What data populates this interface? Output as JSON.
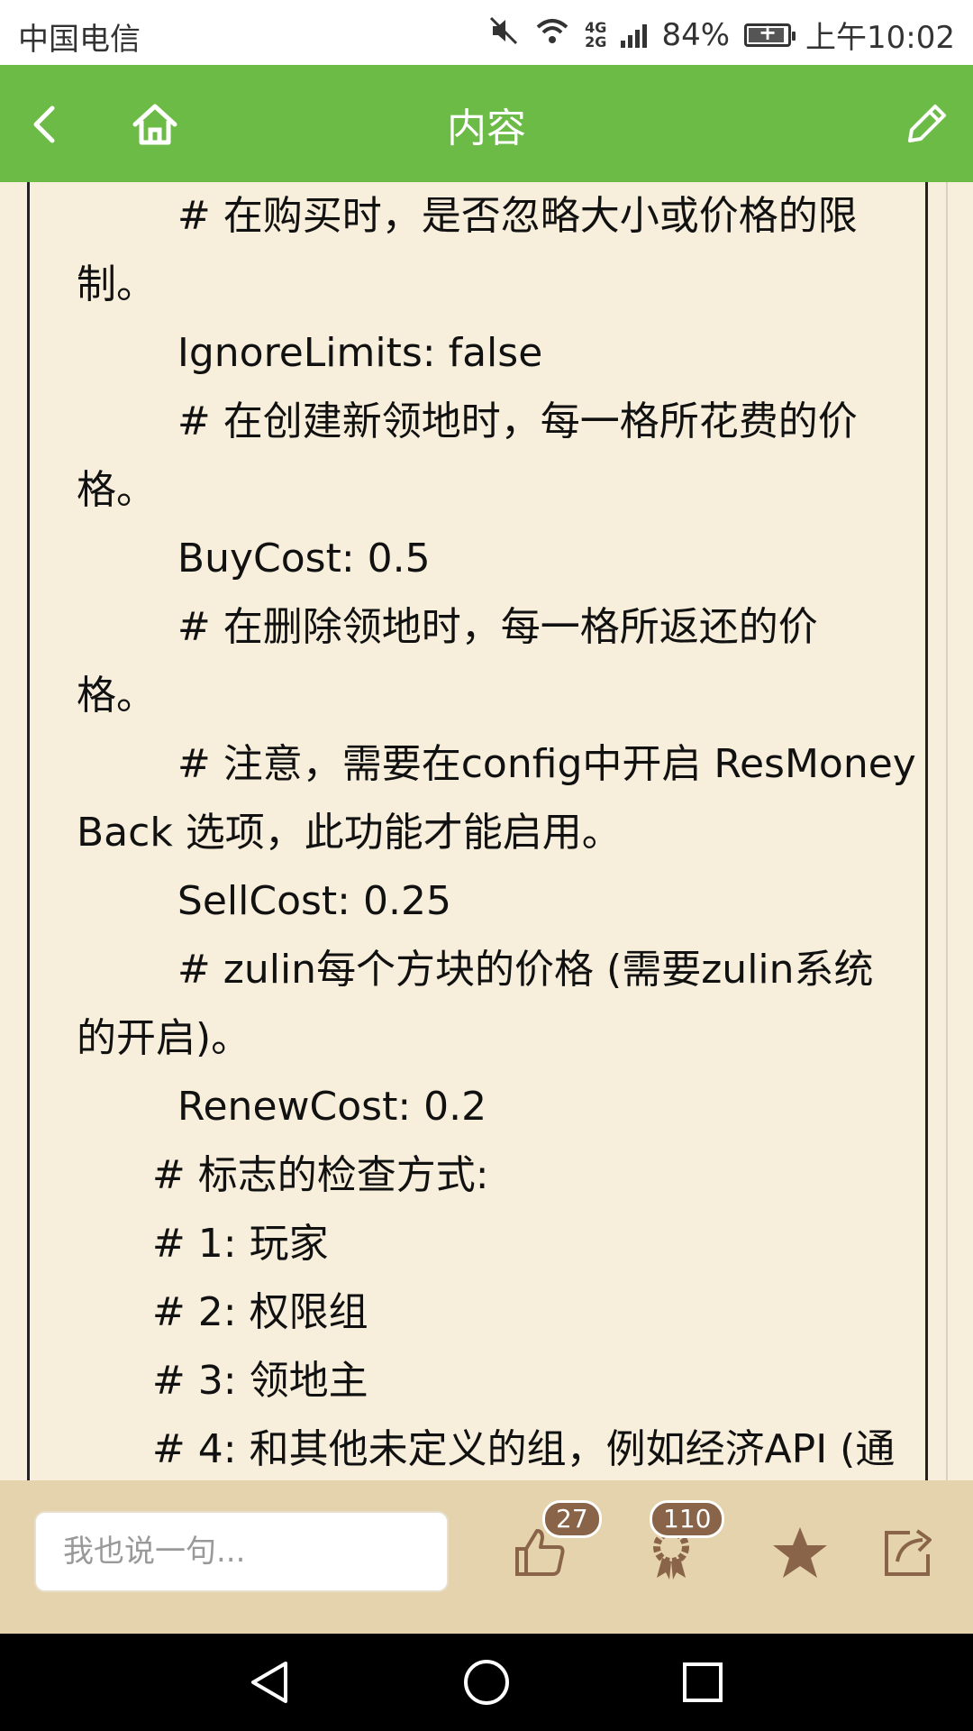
{
  "statusbar": {
    "carrier": "中国电信",
    "net_top": "4G",
    "net_bottom": "2G",
    "battery": "84%",
    "time": "上午10:02",
    "battery_level": 0.84
  },
  "appbar": {
    "title": "内容",
    "back_icon": "chevron-left-icon",
    "home_icon": "home-icon",
    "edit_icon": "pencil-icon"
  },
  "content": {
    "lines": [
      "        # 在购买时，是否忽略大小或价格的限",
      "制。",
      "        IgnoreLimits: false",
      "        # 在创建新领地时，每一格所花费的价",
      "格。",
      "        BuyCost: 0.5",
      "        # 在删除领地时，每一格所返还的价",
      "格。",
      "        # 注意，需要在config中开启 ResMoney",
      "Back 选项，此功能才能启用。",
      "        SellCost: 0.25",
      "        # zulin每个方块的价格 (需要zulin系统",
      "的开启)。",
      "        RenewCost: 0.2",
      "      # 标志的检查方式:",
      "      # 1: 玩家",
      "      # 2: 权限组",
      "      # 3: 领地主",
      "      # 4: 和其他未定义的组，例如经济API (通"
    ]
  },
  "bottombar": {
    "comment_placeholder": "我也说一句...",
    "like_count": "27",
    "award_count": "110",
    "like_icon": "thumbs-up-icon",
    "award_icon": "award-icon",
    "star_icon": "star-icon",
    "share_icon": "share-icon"
  },
  "navbar": {
    "back_icon": "triangle-back-icon",
    "home_icon": "circle-home-icon",
    "recents_icon": "square-recents-icon"
  }
}
